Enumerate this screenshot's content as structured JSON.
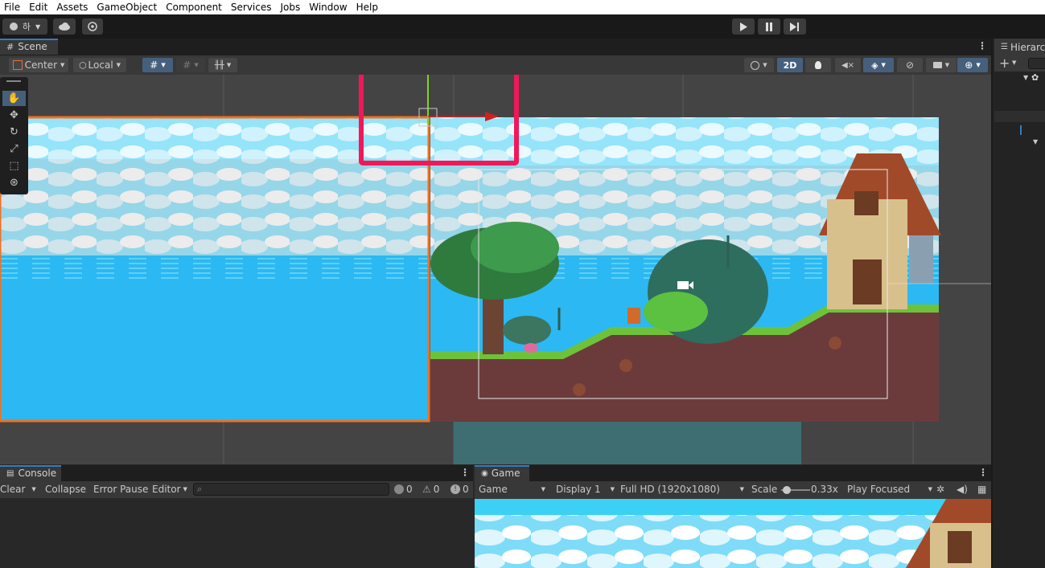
{
  "menu": [
    "File",
    "Edit",
    "Assets",
    "GameObject",
    "Component",
    "Services",
    "Jobs",
    "Window",
    "Help"
  ],
  "toolbar": {
    "account_label": "하",
    "account_icon": "account-icon",
    "cloud_icon": "cloud-icon",
    "collab_icon": "collab-icon",
    "play_icon": "play-icon",
    "pause_icon": "pause-icon",
    "step_icon": "step-icon"
  },
  "scene_tab": {
    "label": "Scene",
    "icon": "grid-icon"
  },
  "hierarchy_tab": {
    "label": "Hierarc"
  },
  "scene_toolbar": {
    "pivot_label": "Center",
    "space_label": "Local",
    "mode_2d_label": "2D"
  },
  "tools": [
    "hand-tool",
    "move-tool",
    "rotate-tool",
    "scale-tool",
    "rect-tool",
    "transform-tool"
  ],
  "console": {
    "tab_label": "Console",
    "clear_label": "Clear",
    "collapse_label": "Collapse",
    "error_pause_label": "Error Pause",
    "editor_label": "Editor",
    "log_count": "0",
    "warn_count": "0",
    "error_count": "0"
  },
  "game": {
    "tab_label": "Game",
    "view_dropdown": "Game",
    "display_dropdown": "Display 1",
    "resolution_dropdown": "Full HD (1920x1080)",
    "scale_label": "Scale",
    "scale_value": "0.33x",
    "play_mode_dropdown": "Play Focused"
  },
  "colors": {
    "highlight_box": "#f0185a",
    "sky": "#3bd0f4",
    "ocean": "#2cb8f2",
    "grass": "#6ec23a",
    "dirt": "#6b3b3b",
    "selection_outline": "#f07020"
  }
}
